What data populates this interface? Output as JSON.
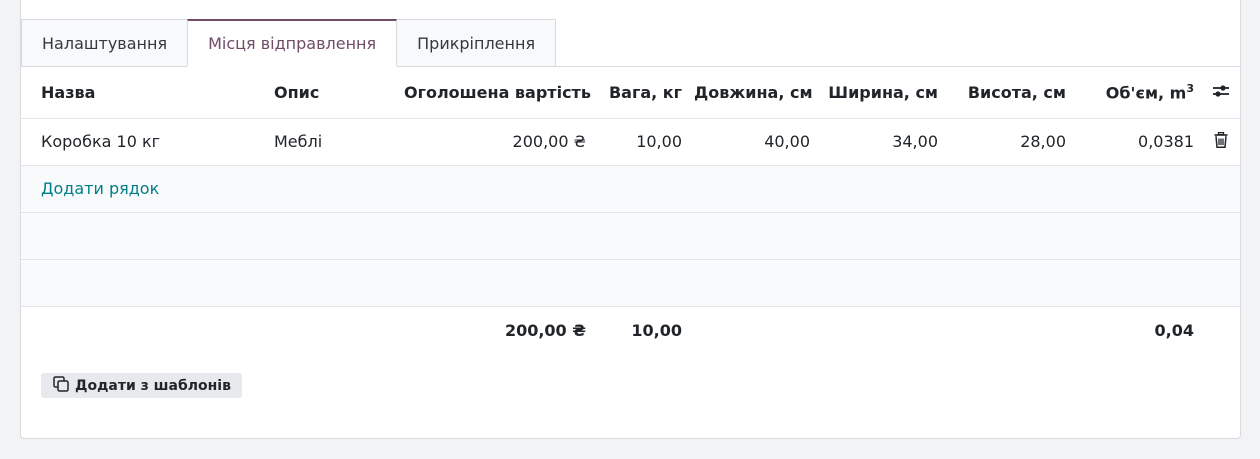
{
  "tabs": [
    {
      "label": "Налаштування",
      "active": false
    },
    {
      "label": "Місця відправлення",
      "active": true
    },
    {
      "label": "Прикріплення",
      "active": false
    }
  ],
  "table": {
    "headers": {
      "name": "Назва",
      "description": "Опис",
      "declared_value": "Оголошена вартість",
      "weight": "Вага, кг",
      "length": "Довжина, см",
      "width": "Ширина, см",
      "height": "Висота, см",
      "volume": "Об'єм, m",
      "volume_sup": "3"
    },
    "rows": [
      {
        "name": "Коробка 10 кг",
        "description": "Меблі",
        "declared_value": "200,00 ₴",
        "weight": "10,00",
        "length": "40,00",
        "width": "34,00",
        "height": "28,00",
        "volume": "0,0381"
      }
    ],
    "add_line_label": "Додати рядок",
    "totals": {
      "declared_value": "200,00 ₴",
      "weight": "10,00",
      "volume": "0,04"
    }
  },
  "add_from_templates_label": "Додати з шаблонів",
  "colors": {
    "accent": "#714b67",
    "link": "#017e84"
  },
  "icons": {
    "row_delete": "trash-icon",
    "column_settings": "sliders-icon",
    "template_button": "copy-icon"
  }
}
